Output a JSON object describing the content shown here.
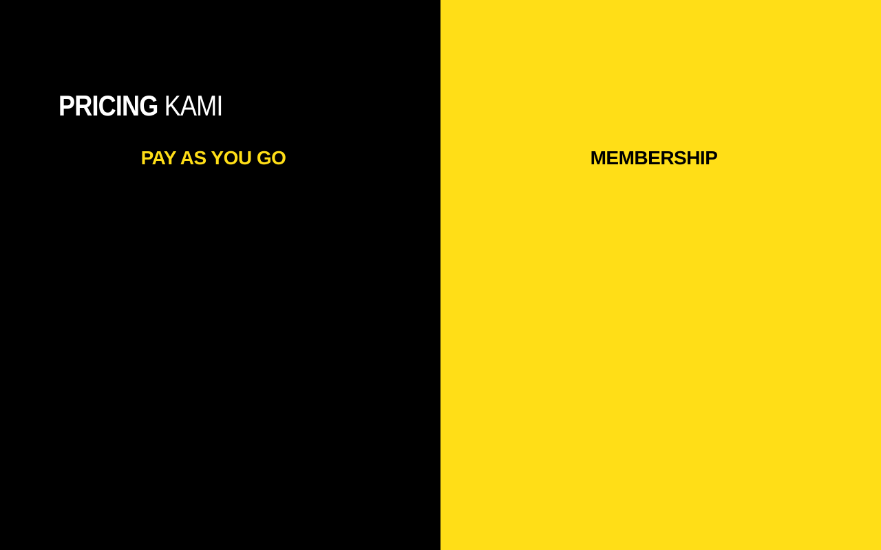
{
  "header": {
    "title_strong": "PRICING",
    "title_light": "KAMI"
  },
  "plans": {
    "left": {
      "label": "PAY AS YOU GO"
    },
    "right": {
      "label": "MEMBERSHIP"
    }
  },
  "colors": {
    "left_background": "#000000",
    "right_background": "#FFDE17",
    "accent_yellow": "#FFDE17",
    "title_text": "#FFFFFF"
  }
}
